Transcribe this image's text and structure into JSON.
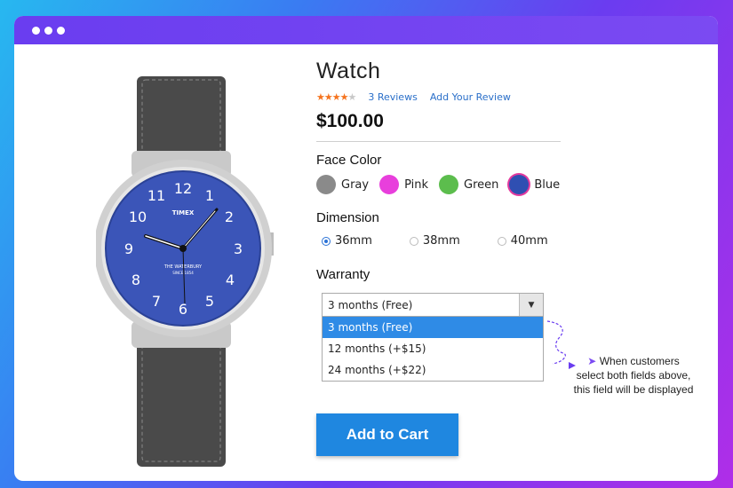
{
  "product": {
    "title": "Watch",
    "rating": 4,
    "rating_max": 5,
    "reviews_link": "3  Reviews",
    "add_review_link": "Add Your Review",
    "price": "$100.00"
  },
  "face_color": {
    "label": "Face Color",
    "options": [
      {
        "label": "Gray",
        "color": "#8a8a8a"
      },
      {
        "label": "Pink",
        "color": "#e83fdc"
      },
      {
        "label": "Green",
        "color": "#5cbd4d"
      },
      {
        "label": "Blue",
        "color": "#2f4fb2"
      }
    ],
    "selected": "Blue"
  },
  "dimension": {
    "label": "Dimension",
    "options": [
      "36mm",
      "38mm",
      "40mm"
    ],
    "selected": "36mm"
  },
  "warranty": {
    "label": "Warranty",
    "selected_value": "3 months (Free)",
    "options": [
      "3 months (Free)",
      "12 months (+$15)",
      "24 months (+$22)"
    ],
    "highlighted": "3 months (Free)"
  },
  "note": {
    "line1": "When customers",
    "line2": "select both fields above,",
    "line3": "this field will be displayed"
  },
  "watch": {
    "brand": "TIMEX",
    "model": "THE WATERBURY",
    "since": "SINCE 1854"
  },
  "cart": {
    "button_label": "Add to Cart"
  },
  "colors": {
    "accent": "#1f87e0",
    "titlebar": "#6a3df0",
    "link": "#2a6fc9",
    "star": "#f5741f"
  }
}
